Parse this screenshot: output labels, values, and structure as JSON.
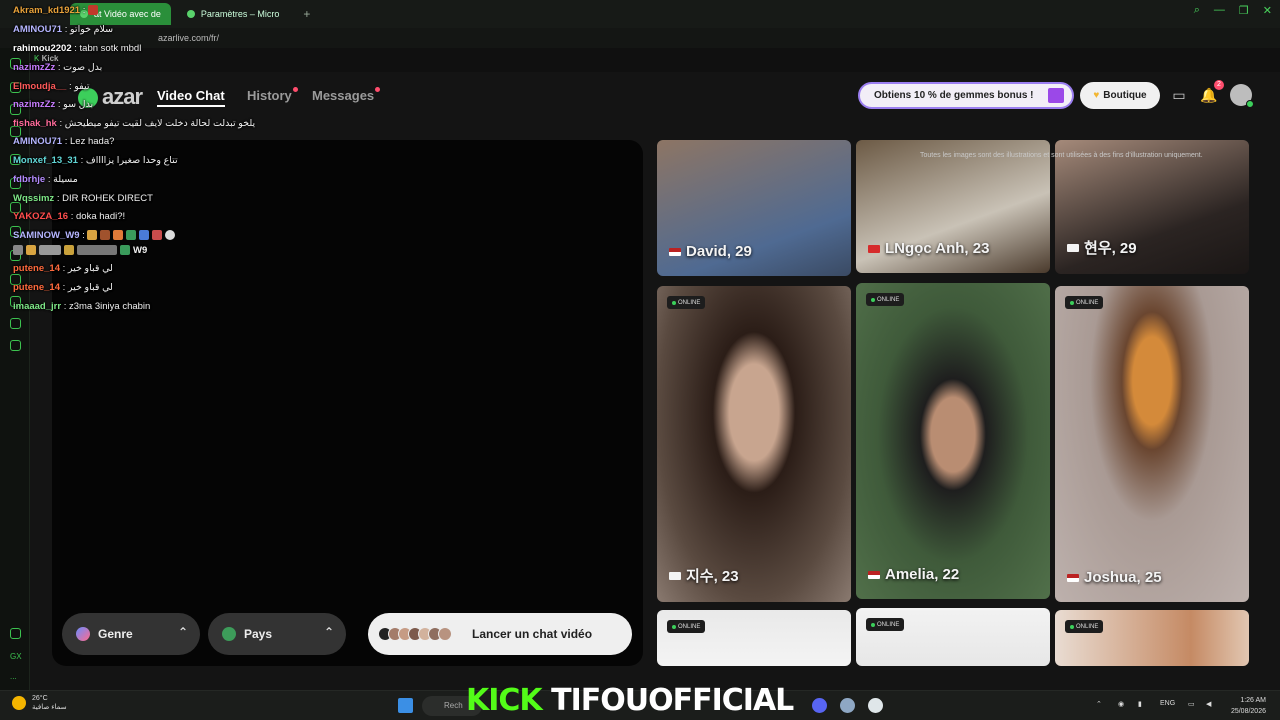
{
  "browser": {
    "tabs": [
      {
        "label": "at Vidéo avec de"
      },
      {
        "label": "Paramètres – Micro"
      }
    ],
    "new_tab": "+",
    "url": "azarlive.com/fr/",
    "bookmark_label": "Kick",
    "window_controls": [
      "⌕",
      "—",
      "❐",
      "✕"
    ]
  },
  "left_rail": {
    "labels": [
      "GX",
      "..."
    ]
  },
  "app": {
    "logo": "azar",
    "nav": [
      {
        "label": "Video Chat",
        "active": true,
        "dot": false
      },
      {
        "label": "History",
        "active": false,
        "dot": true
      },
      {
        "label": "Messages",
        "active": false,
        "dot": true
      }
    ],
    "promo": "Obtiens 10 % de gemmes bonus !",
    "shop": "Boutique",
    "notification_count": "2",
    "disclaimer": "Toutes les images sont des illustrations et sont utilisées à des fins d'illustration uniquement."
  },
  "controls": {
    "genre": "Genre",
    "pays": "Pays",
    "launch": "Lancer un chat vidéo"
  },
  "profiles": [
    {
      "name": "David, 29",
      "online": false
    },
    {
      "name": "LNgọc Anh, 23",
      "online": false
    },
    {
      "name": "현우, 29",
      "online": false
    },
    {
      "name": "지수, 23",
      "online": true
    },
    {
      "name": "Amelia, 22",
      "online": true
    },
    {
      "name": "Joshua, 25",
      "online": true
    },
    {
      "name": "",
      "online": true
    },
    {
      "name": "",
      "online": true
    },
    {
      "name": "",
      "online": true
    }
  ],
  "online_label": "ONLINE",
  "chat": [
    {
      "user": "Akram_kd1921",
      "color": "#e8a23a",
      "text": ""
    },
    {
      "user": "AMINOU71",
      "color": "#b5b5ff",
      "text": "سلام خواتو"
    },
    {
      "user": "rahimou2202",
      "color": "#ffffff",
      "text": "tabn sotk mbdl"
    },
    {
      "user": "nazimzZz",
      "color": "#c77dff",
      "text": "بدل صوت"
    },
    {
      "user": "Elmoudja__",
      "color": "#ff5a5a",
      "text": "تيفو"
    },
    {
      "user": "nazimzZz",
      "color": "#c77dff",
      "text": "بدل سو"
    },
    {
      "user": "fishak_hk",
      "color": "#ff6b9a",
      "text": "يلخو تبدلت لحالة دخلت لايف لقيت تيفو ميطيحش"
    },
    {
      "user": "AMINOU71",
      "color": "#b5b5ff",
      "text": "Lez hada?"
    },
    {
      "user": "Monxef_13_31",
      "color": "#61d6d6",
      "text": "تتاع وحدا صغيرا يزااااف"
    },
    {
      "user": "fdbrhje",
      "color": "#b58cff",
      "text": "مسيلة"
    },
    {
      "user": "Wqssimz",
      "color": "#7ee787",
      "text": "DIR ROHEK DIRECT"
    },
    {
      "user": "YAKOZA_16",
      "color": "#ff4d4d",
      "text": "doka hadi?!"
    },
    {
      "user": "SAMINOW_W9",
      "color": "#b5b5ff",
      "text": ""
    },
    {
      "user": "",
      "color": "#ffffff",
      "text": "W9"
    },
    {
      "user": "putene_14",
      "color": "#ff6a3d",
      "text": "لي قباو خير"
    },
    {
      "user": "putene_14",
      "color": "#ff6a3d",
      "text": "لي قباو خير"
    },
    {
      "user": "imaaad_jrr",
      "color": "#7ee787",
      "text": "z3ma 3iniya chabin"
    }
  ],
  "taskbar": {
    "temp": "26°C",
    "weather_desc": "سماء صافية",
    "search": "Rech",
    "overlay_kick": "KICK",
    "overlay_name": "TIFOUOFFICIAL",
    "lang": "ENG",
    "time": "1:26 AM",
    "date": "25/08/2026"
  }
}
